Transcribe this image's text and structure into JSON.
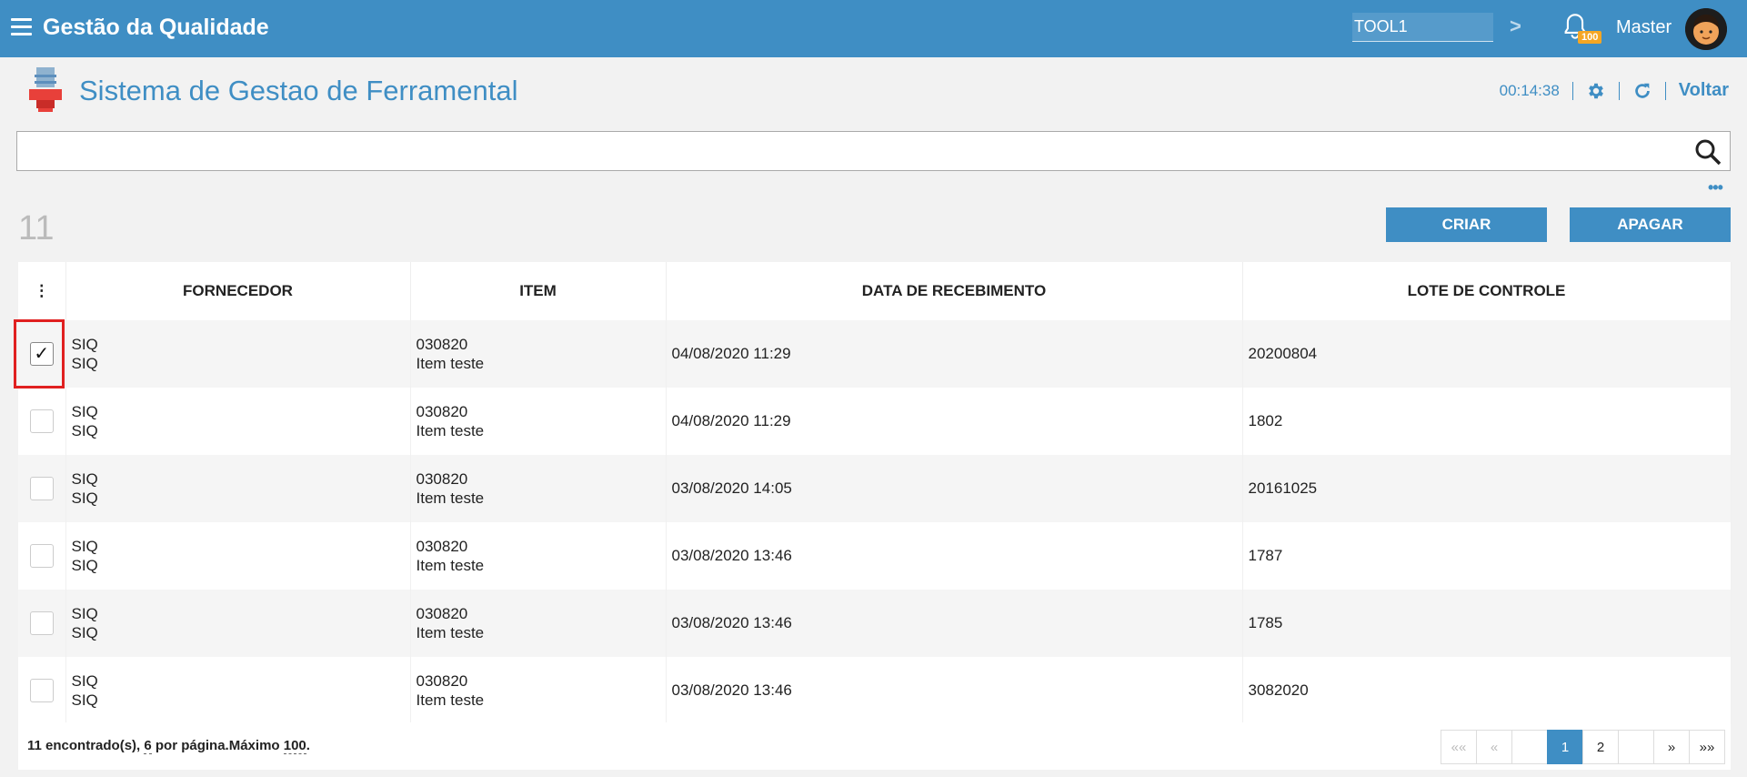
{
  "app": {
    "title": "Gestão da Qualidade"
  },
  "topbar": {
    "module": "TOOL1",
    "notifications": "100",
    "user": "Master"
  },
  "page": {
    "title": "Sistema de Gestao de Ferramental",
    "timer": "00:14:38",
    "back_label": "Voltar"
  },
  "search": {
    "value": "",
    "placeholder": "",
    "more": "•••"
  },
  "count": "11",
  "actions": {
    "create": "CRIAR",
    "delete": "APAGAR"
  },
  "table": {
    "columns": [
      "FORNECEDOR",
      "ITEM",
      "DATA DE RECEBIMENTO",
      "LOTE DE CONTROLE"
    ],
    "rows": [
      {
        "checked": true,
        "fornecedor1": "SIQ",
        "fornecedor2": "SIQ",
        "item1": "030820",
        "item2": "Item teste",
        "data": "04/08/2020 11:29",
        "lote": "20200804"
      },
      {
        "checked": false,
        "fornecedor1": "SIQ",
        "fornecedor2": "SIQ",
        "item1": "030820",
        "item2": "Item teste",
        "data": "04/08/2020 11:29",
        "lote": "1802"
      },
      {
        "checked": false,
        "fornecedor1": "SIQ",
        "fornecedor2": "SIQ",
        "item1": "030820",
        "item2": "Item teste",
        "data": "03/08/2020 14:05",
        "lote": "20161025"
      },
      {
        "checked": false,
        "fornecedor1": "SIQ",
        "fornecedor2": "SIQ",
        "item1": "030820",
        "item2": "Item teste",
        "data": "03/08/2020 13:46",
        "lote": "1787"
      },
      {
        "checked": false,
        "fornecedor1": "SIQ",
        "fornecedor2": "SIQ",
        "item1": "030820",
        "item2": "Item teste",
        "data": "03/08/2020 13:46",
        "lote": "1785"
      },
      {
        "checked": false,
        "fornecedor1": "SIQ",
        "fornecedor2": "SIQ",
        "item1": "030820",
        "item2": "Item teste",
        "data": "03/08/2020 13:46",
        "lote": "3082020"
      }
    ]
  },
  "footer": {
    "found": "11",
    "found_label": " encontrado(s), ",
    "per_page": "6",
    "per_page_label": " por página.Máximo ",
    "max": "100",
    "end": "."
  },
  "pager": {
    "first": "««",
    "prev": "«",
    "pages": [
      "1",
      "2"
    ],
    "next": "»",
    "last": "»»"
  }
}
